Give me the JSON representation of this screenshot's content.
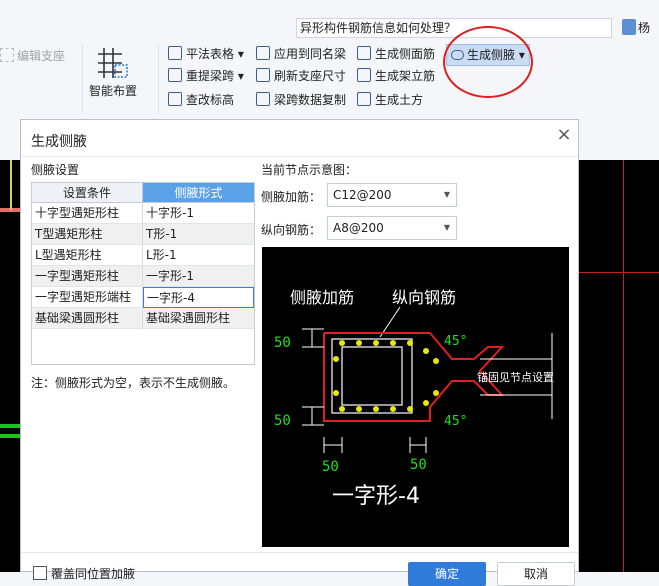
{
  "topbar": {
    "help_search": "异形构件钢筋信息如何处理？",
    "user_name": "杨"
  },
  "ribbon": {
    "edit_support": "编辑支座",
    "smart_layout": "智能布置",
    "tools": [
      {
        "label": "平法表格",
        "dropdown": true
      },
      {
        "label": "应用到同名梁"
      },
      {
        "label": "生成侧面筋"
      },
      {
        "label": "生成侧腋",
        "dropdown": true
      },
      {
        "label": "重提梁跨",
        "dropdown": true
      },
      {
        "label": "刷新支座尺寸"
      },
      {
        "label": "生成架立筋"
      },
      {
        "label": "查改标高"
      },
      {
        "label": "梁跨数据复制"
      },
      {
        "label": "生成土方"
      }
    ]
  },
  "dialog": {
    "title": "生成侧腋",
    "close": "×",
    "settings_label": "侧腋设置",
    "columns": [
      "设置条件",
      "侧腋形式"
    ],
    "rows": [
      {
        "condition": "十字型遇矩形柱",
        "form": "十字形-1"
      },
      {
        "condition": "T型遇矩形柱",
        "form": "T形-1"
      },
      {
        "condition": "L型遇矩形柱",
        "form": "L形-1"
      },
      {
        "condition": "一字型遇矩形柱",
        "form": "一字形-1"
      },
      {
        "condition": "一字型遇矩形端柱",
        "form": "一字形-4"
      },
      {
        "condition": "基础梁遇圆形柱",
        "form": "基础梁遇圆形柱"
      }
    ],
    "note": "注：侧腋形式为空，表示不生成侧腋。",
    "preview_label": "当前节点示意图：",
    "side_rebar_label": "侧腋加筋：",
    "side_rebar_value": "C12@200",
    "long_rebar_label": "纵向钢筋：",
    "long_rebar_value": "A8@200",
    "diagram": {
      "label_side": "侧腋加筋",
      "label_long": "纵向钢筋",
      "dim_50a": "50",
      "dim_50b": "50",
      "dim_50c": "50",
      "dim_50d": "50",
      "angle_a": "45°",
      "angle_b": "45°",
      "anchor_note": "锚固见节点设置",
      "caption": "一字形-4"
    },
    "checkbox_label": "覆盖同位置加腋",
    "ok": "确定",
    "cancel": "取消"
  },
  "colors": {
    "accent": "#2f7bd9",
    "highlight": "#e02020",
    "rebar": "#e8e800",
    "dimension": "#22dd22"
  }
}
